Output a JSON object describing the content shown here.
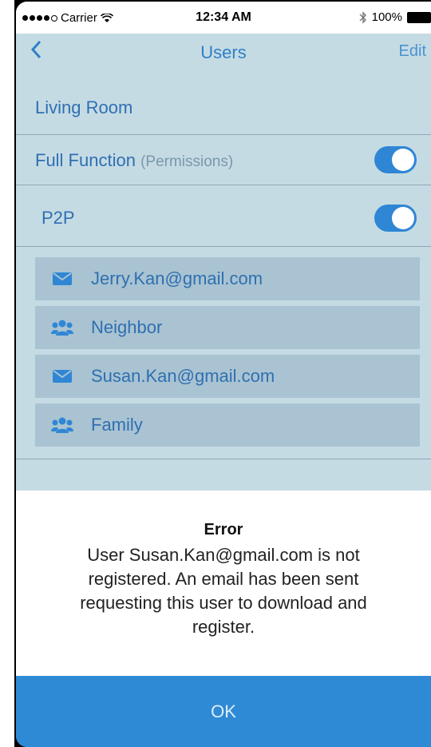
{
  "status": {
    "carrier": "Carrier",
    "time": "12:34 AM",
    "battery": "100%"
  },
  "nav": {
    "back_glyph": "<",
    "title": "Users",
    "edit_label": "Edit"
  },
  "room": {
    "name": "Living Room"
  },
  "settings": [
    {
      "label": "Full Function",
      "sublabel": "(Permissions)",
      "enabled": true
    },
    {
      "label": "P2P",
      "enabled": true
    }
  ],
  "users": [
    {
      "icon": "mail-icon",
      "label": "Jerry.Kan@gmail.com"
    },
    {
      "icon": "group-icon",
      "label": "Neighbor"
    },
    {
      "icon": "mail-icon",
      "label": "Susan.Kan@gmail.com"
    },
    {
      "icon": "group-icon",
      "label": "Family"
    }
  ],
  "dialog": {
    "title": "Error",
    "message": "User Susan.Kan@gmail.com is not registered. An email has been sent requesting this user to download and register.",
    "ok_label": "OK"
  },
  "colors": {
    "accent": "#2f86d4",
    "background": "#c5dbe4",
    "item_bg": "#a9c3d2",
    "text_blue": "#2f6fb1"
  }
}
